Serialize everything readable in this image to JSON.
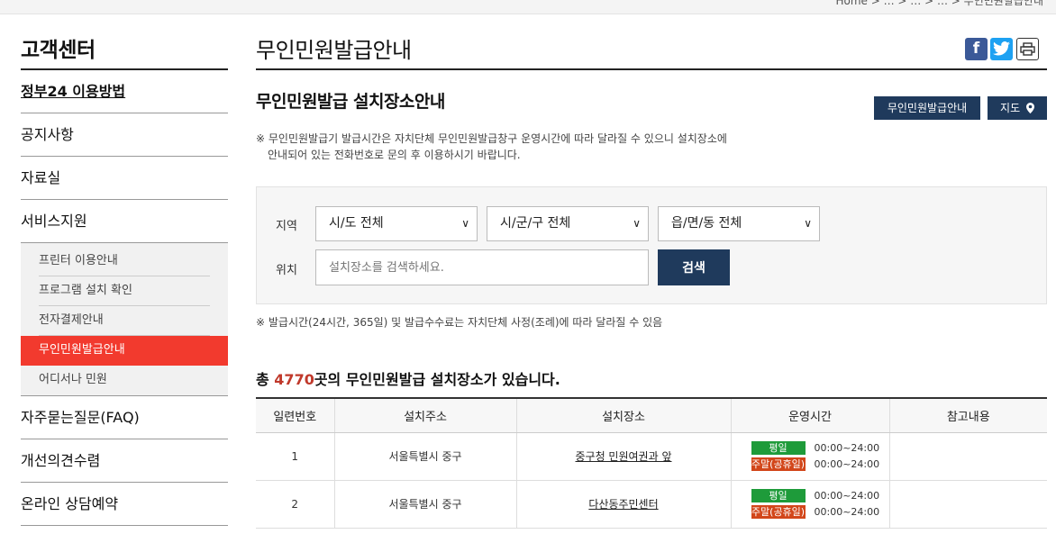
{
  "header": {
    "breadcrumb": "Home > … > … > … > 무인민원발급안내"
  },
  "sidebar": {
    "title": "고객센터",
    "items": [
      {
        "label": "정부24 이용방법"
      },
      {
        "label": "공지사항"
      },
      {
        "label": "자료실"
      },
      {
        "label": "서비스지원"
      }
    ],
    "sub_items": [
      {
        "label": "프린터 이용안내"
      },
      {
        "label": "프로그램 설치 확인"
      },
      {
        "label": "전자결제안내"
      },
      {
        "label": "무인민원발급안내"
      },
      {
        "label": "어디서나 민원"
      }
    ],
    "items_after": [
      {
        "label": "자주묻는질문(FAQ)"
      },
      {
        "label": "개선의견수렴"
      },
      {
        "label": "온라인 상담예약"
      }
    ]
  },
  "main": {
    "page_title": "무인민원발급안내",
    "share_icons": [
      "facebook-icon",
      "twitter-icon",
      "print-icon"
    ],
    "section_title": "무인민원발급 설치장소안내",
    "guide_button": "무인민원발급안내",
    "map_button": "지도",
    "notice_line1": "※ 무인민원발급기 발급시간은 자치단체 무인민원발급창구 운영시간에 따라 달라질 수 있으니 설치장소에",
    "notice_line2": "안내되어 있는 전화번호로 문의 후 이용하시기 바랍니다.",
    "search": {
      "region_label": "지역",
      "location_label": "위치",
      "sido": "시/도 전체",
      "sigungu": "시/군/구 전체",
      "eupmyeon": "읍/면/동 전체",
      "placeholder": "설치장소를 검색하세요.",
      "search_button": "검색"
    },
    "notice2": "※ 발급시간(24시간, 365일) 및 발급수수료는 자치단체 사정(조례)에 따라 달라질 수 있음",
    "total": {
      "prefix": "총 ",
      "count": "4770",
      "suffix": "곳의 무인민원발급 설치장소가 있습니다."
    },
    "table": {
      "headers": [
        "일련번호",
        "설치주소",
        "설치장소",
        "운영시간",
        "참고내용"
      ],
      "weekday_label": "평일",
      "weekend_label": "주말(공휴일)",
      "rows": [
        {
          "no": "1",
          "address": "서울특별시 중구",
          "place": "중구청 민원여권과 앞",
          "weekday": "00:00~24:00",
          "weekend": "00:00~24:00",
          "note": ""
        },
        {
          "no": "2",
          "address": "서울특별시 중구",
          "place": "다산동주민센터",
          "weekday": "00:00~24:00",
          "weekend": "00:00~24:00",
          "note": ""
        }
      ]
    }
  },
  "colors": {
    "accent_red": "#f23a2e",
    "navy": "#1f3a5c",
    "green": "#1e9b3a",
    "orange": "#d2461a"
  }
}
